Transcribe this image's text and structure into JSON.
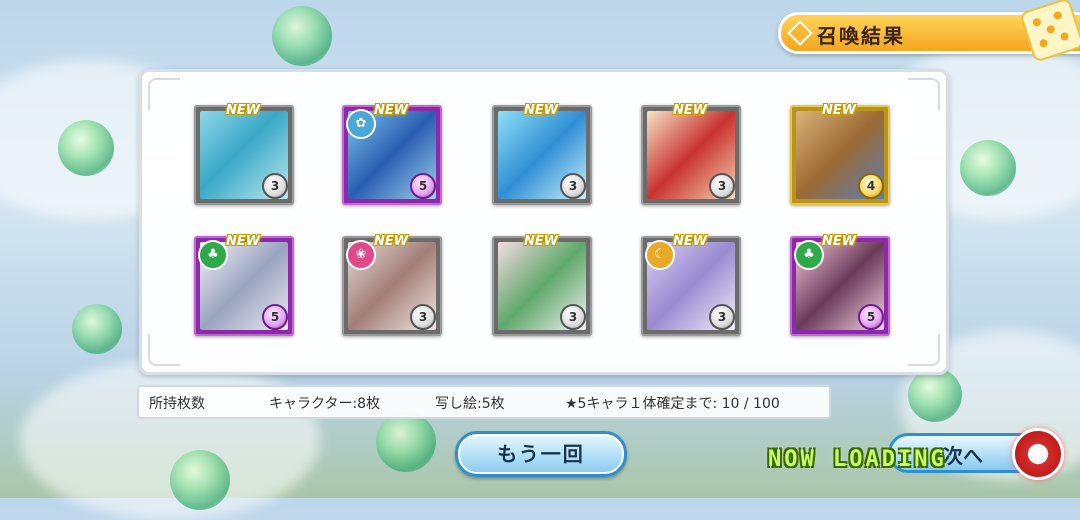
{
  "header": {
    "title": "召喚結果"
  },
  "cards": [
    {
      "badge": "NEW",
      "rarity": "3",
      "frame": "frame3",
      "element": "",
      "art": "linear-gradient(135deg,#8fd7e8 0%,#3aa8c6 45%,#b9e8ef 100%)"
    },
    {
      "badge": "NEW",
      "rarity": "5",
      "frame": "frame5",
      "element": "✿",
      "elemColor": "#4aa8d8",
      "art": "linear-gradient(135deg,#7cc6f0 0%,#2a5db0 50%,#9fd0ef 100%)"
    },
    {
      "badge": "NEW",
      "rarity": "3",
      "frame": "frame3",
      "element": "",
      "art": "linear-gradient(135deg,#8fe0f4 0%,#2f8ed4 50%,#c9f0fb 100%)"
    },
    {
      "badge": "NEW",
      "rarity": "3",
      "frame": "frame3",
      "element": "",
      "art": "linear-gradient(135deg,#f5e5c8 0%,#c8322f 50%,#f3d3b0 100%)"
    },
    {
      "badge": "NEW",
      "rarity": "4",
      "frame": "frame4",
      "element": "",
      "art": "linear-gradient(135deg,#d9b27a 0%,#9b6a32 50%,#5a7fb8 100%)"
    },
    {
      "badge": "NEW",
      "rarity": "5",
      "frame": "frame5",
      "element": "♣",
      "elemColor": "#2eaa4a",
      "art": "linear-gradient(135deg,#f3f3f8 0%,#9aa4c0 50%,#e8e8f0 100%)"
    },
    {
      "badge": "NEW",
      "rarity": "3",
      "frame": "frame3",
      "element": "❀",
      "elemColor": "#e04a8a",
      "art": "linear-gradient(135deg,#e5d8d2 0%,#a27f78 50%,#f2e6e0 100%)"
    },
    {
      "badge": "NEW",
      "rarity": "3",
      "frame": "frame3",
      "element": "",
      "art": "linear-gradient(135deg,#f5dbe3 0%,#5fa86a 50%,#f2f2f2 100%)"
    },
    {
      "badge": "NEW",
      "rarity": "3",
      "frame": "frame3",
      "element": "☾",
      "elemColor": "#e8a828",
      "art": "linear-gradient(135deg,#d8d0f2 0%,#9a8ad0 50%,#f2eefa 100%)"
    },
    {
      "badge": "NEW",
      "rarity": "5",
      "frame": "frame5",
      "element": "♣",
      "elemColor": "#2eaa4a",
      "art": "linear-gradient(135deg,#f6c8d8 0%,#6a3a5a 50%,#f2d2de 100%)"
    }
  ],
  "info": {
    "owned": "所持枚数",
    "characters": "キャラクター:8枚",
    "pictures": "写し絵:5枚",
    "guarantee": "★5キャラ１体確定まで: 10 / 100"
  },
  "buttons": {
    "again": "もう一回",
    "next": "次へ"
  },
  "status": {
    "loading": "NOW LOADING"
  }
}
